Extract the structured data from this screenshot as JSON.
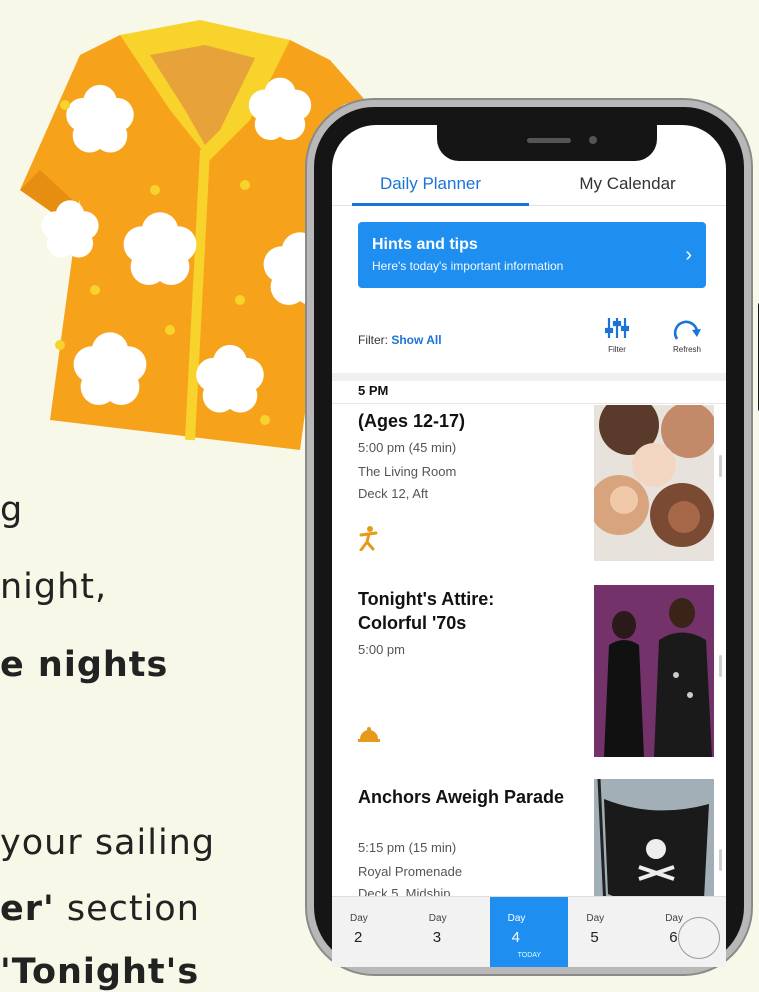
{
  "background_text": {
    "line1": "g",
    "line2": "night,",
    "line3_bold": "e nights",
    "line4": "your sailing",
    "line5_bold": "er'",
    "line5_rest": " section",
    "line6_bold": "'Tonight's"
  },
  "app": {
    "tabs": [
      {
        "label": "Daily Planner",
        "active": true
      },
      {
        "label": "My Calendar",
        "active": false
      }
    ],
    "hint": {
      "title": "Hints and tips",
      "subtitle": "Here's today's important information",
      "chevron": "›"
    },
    "filter": {
      "prefix": "Filter:",
      "value": "Show All",
      "filter_label": "Filter",
      "refresh_label": "Refresh"
    },
    "time_header": "5 PM",
    "events": [
      {
        "title": "(Ages 12-17)",
        "time": "5:00 pm (45 min)",
        "venue": "The Living Room",
        "location": "Deck 12, Aft",
        "icon": "activity-person-icon"
      },
      {
        "title": "Tonight's Attire: Colorful '70s",
        "time": "5:00 pm",
        "icon": "dining-bell-icon"
      },
      {
        "title": "Anchors Aweigh Parade",
        "time": "5:15 pm (15 min)",
        "venue": "Royal Promenade",
        "location": "Deck 5, Midship"
      }
    ],
    "days": [
      {
        "label": "Day",
        "num": "2"
      },
      {
        "label": "Day",
        "num": "3"
      },
      {
        "label": "Day",
        "num": "4",
        "active": true,
        "sub": "TODAY"
      },
      {
        "label": "Day",
        "num": "5"
      },
      {
        "label": "Day",
        "num": "6"
      }
    ]
  },
  "colors": {
    "accent": "#1a73d8",
    "banner": "#1e8ef0",
    "shirt": "#f7a21b",
    "shirt_collar": "#f8d32c",
    "icon_orange": "#e69a1c"
  }
}
